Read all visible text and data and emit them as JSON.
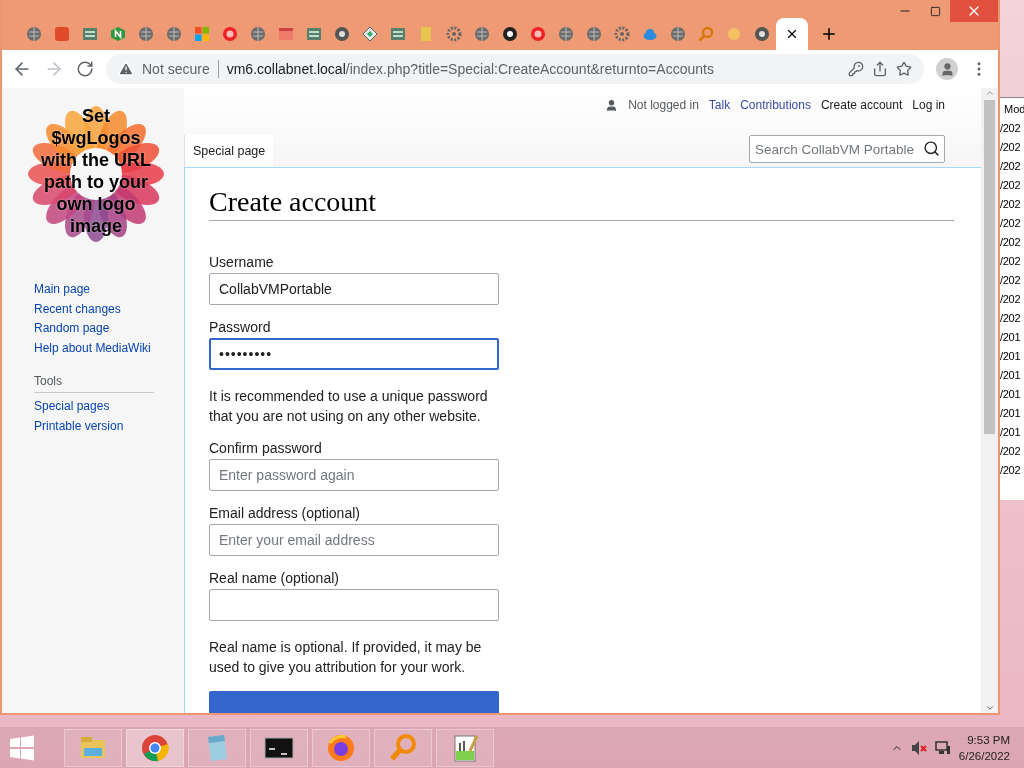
{
  "browser": {
    "tabs": [
      {
        "kind": "globe",
        "selected": false
      },
      {
        "kind": "red-app",
        "selected": false
      },
      {
        "kind": "sqlite",
        "selected": false
      },
      {
        "kind": "n-hex",
        "selected": false
      },
      {
        "kind": "globe",
        "selected": false
      },
      {
        "kind": "globe",
        "selected": false
      },
      {
        "kind": "windows",
        "selected": false
      },
      {
        "kind": "red-circle",
        "selected": false
      },
      {
        "kind": "globe",
        "selected": false
      },
      {
        "kind": "calendar",
        "selected": false
      },
      {
        "kind": "sqlite",
        "selected": false
      },
      {
        "kind": "chrome",
        "selected": false
      },
      {
        "kind": "diamond",
        "selected": false
      },
      {
        "kind": "sqlite",
        "selected": false
      },
      {
        "kind": "folder",
        "selected": false
      },
      {
        "kind": "gear",
        "selected": false
      },
      {
        "kind": "globe",
        "selected": false
      },
      {
        "kind": "wiki",
        "selected": false
      },
      {
        "kind": "red-circle",
        "selected": false
      },
      {
        "kind": "globe",
        "selected": false
      },
      {
        "kind": "globe",
        "selected": false
      },
      {
        "kind": "gear",
        "selected": false
      },
      {
        "kind": "cloud",
        "selected": false
      },
      {
        "kind": "globe",
        "selected": false
      },
      {
        "kind": "magnifier",
        "selected": false
      },
      {
        "kind": "sun",
        "selected": false
      },
      {
        "kind": "chrome",
        "selected": false
      },
      {
        "selected": true
      }
    ],
    "security": "Not secure",
    "url_host": "vm6.collabnet.local",
    "url_path": "/index.php?title=Special:CreateAccount&returnto=Accounts"
  },
  "sidebar": {
    "logo_lines": [
      "Set",
      "$wgLogos",
      "with the URL",
      "path to your",
      "own logo",
      "image"
    ],
    "navigation": [
      "Main page",
      "Recent changes",
      "Random page",
      "Help about MediaWiki"
    ],
    "tools_heading": "Tools",
    "tools": [
      "Special pages",
      "Printable version"
    ]
  },
  "personal": {
    "status": "Not logged in",
    "links": [
      "Talk",
      "Contributions",
      "Create account",
      "Log in"
    ]
  },
  "page_tab": "Special page",
  "search": {
    "placeholder": "Search CollabVM Portable"
  },
  "heading": "Create account",
  "form": {
    "fields": [
      {
        "kind": "text",
        "label": "Username",
        "value": "CollabVMPortable",
        "focused": false
      },
      {
        "kind": "password",
        "label": "Password",
        "value": "•••••••••",
        "focused": true,
        "help": "It is recommended to use a unique password that you are not using on any other website."
      },
      {
        "kind": "text",
        "label": "Confirm password",
        "placeholder": "Enter password again",
        "focused": false
      },
      {
        "kind": "text",
        "label": "Email address (optional)",
        "placeholder": "Enter your email address",
        "focused": false
      },
      {
        "kind": "text",
        "label": "Real name (optional)",
        "focused": false,
        "help": "Real name is optional. If provided, it may be used to give you attribution for your work."
      }
    ]
  },
  "background_window": {
    "header": "Mod",
    "cells": [
      "/202",
      "/202",
      "/202",
      "/202",
      "/202",
      "/202",
      "/202",
      "/202",
      "/202",
      "/202",
      "/202",
      "/201",
      "/201",
      "/201",
      "/201",
      "/201",
      "/201",
      "/202",
      "/202"
    ]
  },
  "taskbar": {
    "apps": [
      {
        "kind": "explorer",
        "selected": false
      },
      {
        "kind": "chrome",
        "selected": true
      },
      {
        "kind": "notepad",
        "selected": false
      },
      {
        "kind": "terminal",
        "selected": false
      },
      {
        "kind": "firefox",
        "selected": false
      },
      {
        "kind": "magnifier",
        "selected": false
      },
      {
        "kind": "notepadpp",
        "selected": false
      }
    ],
    "time": "9:53 PM",
    "date": "6/26/2022"
  }
}
